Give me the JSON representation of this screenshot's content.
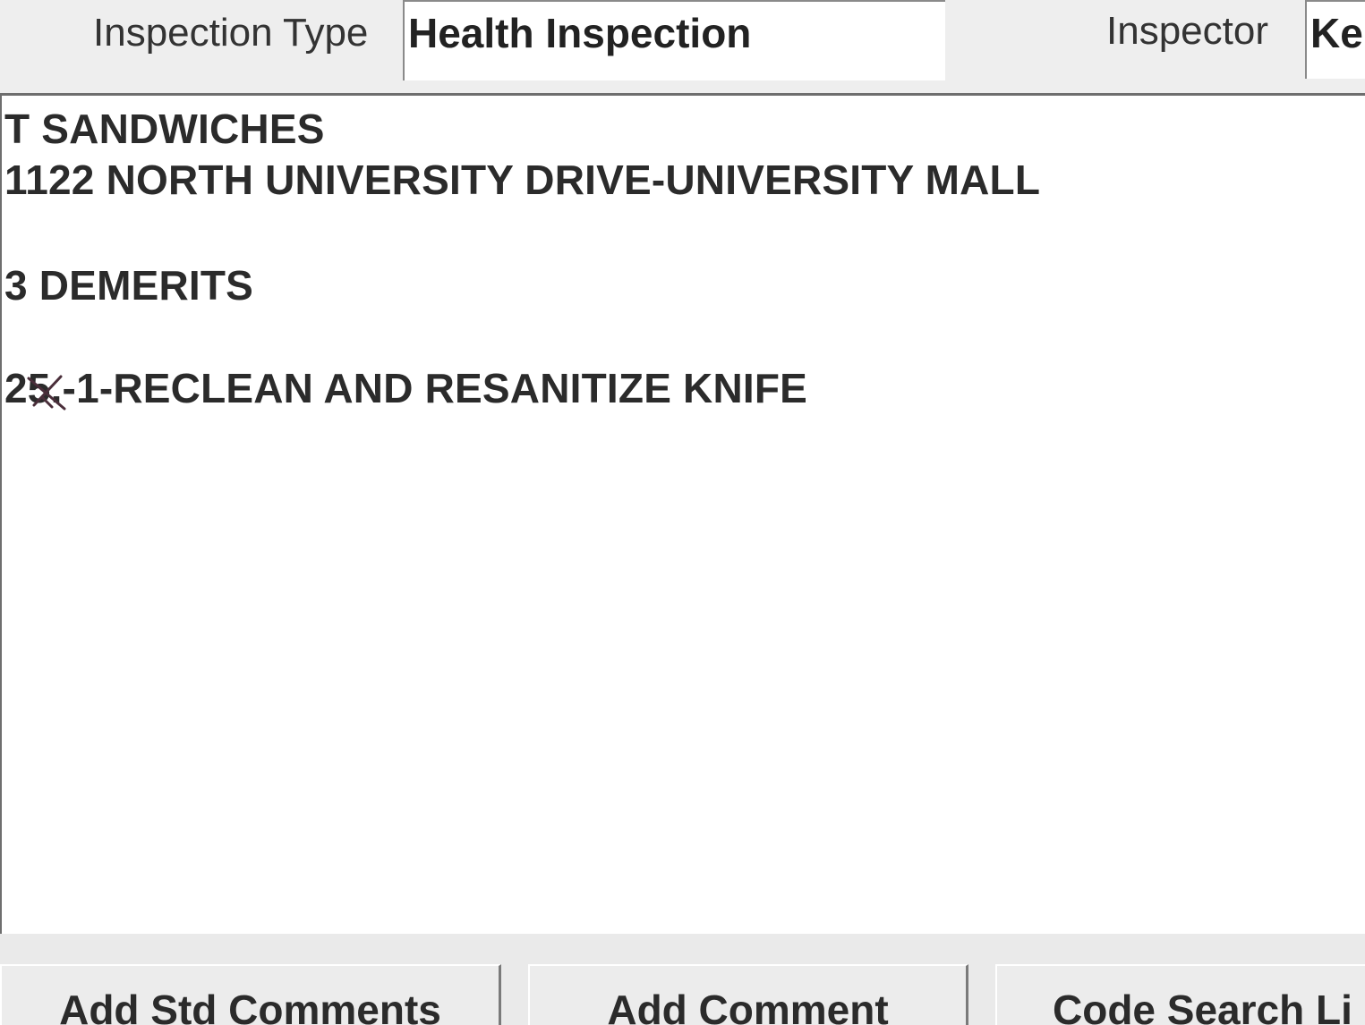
{
  "header": {
    "inspection_type_label": "Inspection Type",
    "inspection_type_value": "Health Inspection",
    "inspector_label": "Inspector",
    "inspector_value": "Ke"
  },
  "comments": {
    "lines": [
      "T SANDWICHES",
      "1122 NORTH UNIVERSITY DRIVE-UNIVERSITY MALL",
      "3 DEMERITS",
      "25.-1-RECLEAN AND RESANITIZE KNIFE"
    ]
  },
  "buttons": {
    "add_std_comments": {
      "pre": "Add ",
      "mnemonic": "S",
      "post": "td Comments"
    },
    "add_comment": {
      "mnemonic": "A",
      "post": "dd Comment"
    },
    "code_search": {
      "label": "Code Search Li"
    }
  }
}
